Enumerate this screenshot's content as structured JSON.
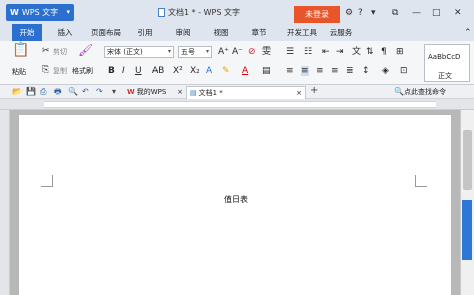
{
  "titlebar": {
    "app_label": "WPS 文字",
    "app_letter": "W",
    "window_title": "文档1 * - WPS 文字",
    "login_label": "未登录"
  },
  "menu": {
    "tabs": [
      "开始",
      "插入",
      "页面布局",
      "引用",
      "审阅",
      "视图",
      "章节",
      "开发工具",
      "云服务"
    ]
  },
  "ribbon": {
    "paste": "粘贴",
    "cut": "剪切",
    "copy": "复制",
    "format_painter": "格式刷",
    "font_name": "宋体 (正文)",
    "font_size": "五号",
    "style_sample": "AaBbCcD",
    "style_name": "正文"
  },
  "quickbar": {
    "tab_wps": "我的WPS",
    "tab_doc": "文档1 *",
    "find_command": "点此查找命令"
  },
  "document": {
    "text": "值日表"
  },
  "colors": {
    "accent": "#2b6fcf",
    "login": "#e8552b",
    "wps_red": "#d7312a"
  }
}
